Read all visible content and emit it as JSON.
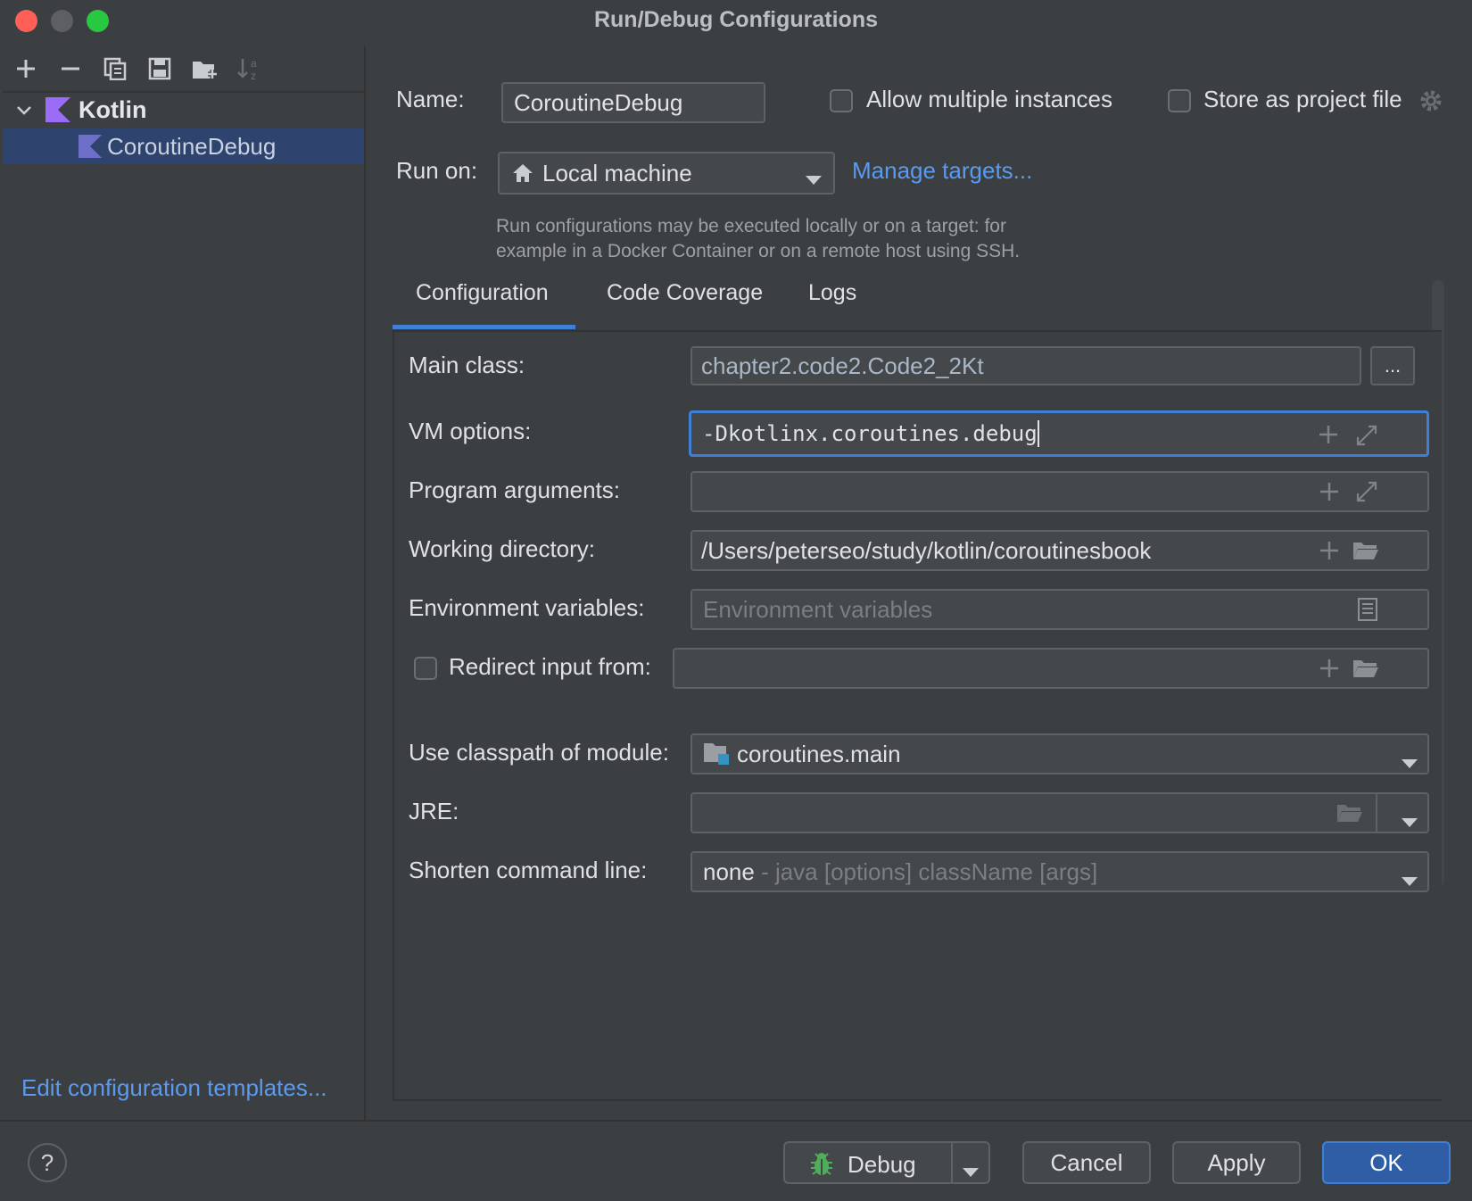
{
  "window": {
    "title": "Run/Debug Configurations"
  },
  "sidebar": {
    "group_label": "Kotlin",
    "item_label": "CoroutineDebug",
    "edit_templates": "Edit configuration templates..."
  },
  "header": {
    "name_label": "Name:",
    "name_value": "CoroutineDebug",
    "allow_multiple": "Allow multiple instances",
    "store_project": "Store as project file",
    "run_on_label": "Run on:",
    "run_on_value": "Local machine",
    "manage_targets": "Manage targets...",
    "hint_line1": "Run configurations may be executed locally or on a target: for",
    "hint_line2": "example in a Docker Container or on a remote host using SSH."
  },
  "tabs": [
    "Configuration",
    "Code Coverage",
    "Logs"
  ],
  "form": {
    "main_class_label": "Main class:",
    "main_class_value": "chapter2.code2.Code2_2Kt",
    "browse_label": "...",
    "vm_options_label": "VM options:",
    "vm_options_value": "-Dkotlinx.coroutines.debug",
    "program_args_label": "Program arguments:",
    "program_args_value": "",
    "working_dir_label": "Working directory:",
    "working_dir_value": "/Users/peterseo/study/kotlin/coroutinesbook",
    "env_vars_label": "Environment variables:",
    "env_vars_placeholder": "Environment variables",
    "redirect_label": "Redirect input from:",
    "classpath_label": "Use classpath of module:",
    "classpath_value": "coroutines.main",
    "jre_label": "JRE:",
    "shorten_label": "Shorten command line:",
    "shorten_value": "none",
    "shorten_desc": " - java [options] className [args]"
  },
  "buttons": {
    "help": "?",
    "debug": "Debug",
    "cancel": "Cancel",
    "apply": "Apply",
    "ok": "OK"
  },
  "colors": {
    "accent": "#3f7fd6",
    "link": "#5a9af0",
    "selection": "#2e436e",
    "ok_button": "#2f5ea7",
    "kotlin_icon": "#9b6cf5"
  }
}
